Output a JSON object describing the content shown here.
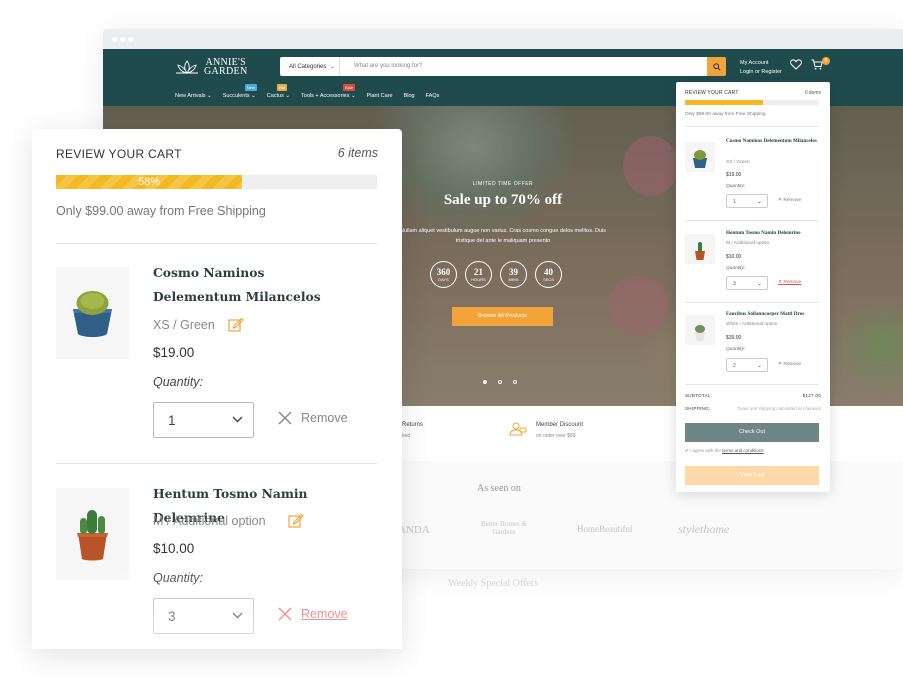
{
  "site": {
    "logo_line1": "ANNIE'S",
    "logo_line2": "GARDEN",
    "category_label": "All Categories",
    "search_placeholder": "What are you looking for?",
    "account_line1": "My Account",
    "account_line2": "Login or Register",
    "cart_count": "6",
    "nav": [
      {
        "label": "New Arrivals",
        "tag": ""
      },
      {
        "label": "Succulents",
        "tag": "New"
      },
      {
        "label": "Cactus",
        "tag": "Hot"
      },
      {
        "label": "Tools + Accessories",
        "tag": "Sale"
      },
      {
        "label": "Plant Care",
        "tag": ""
      },
      {
        "label": "Blog",
        "tag": ""
      },
      {
        "label": "FAQs",
        "tag": ""
      }
    ],
    "colors": {
      "header": "#1f4b4c",
      "accent": "#f2a33a",
      "progress": "#f4b823",
      "tag_new": "#4aa7e0",
      "tag_hot": "#e2b04a",
      "tag_sale": "#d94c3d"
    }
  },
  "hero": {
    "offer": "LIMITED TIME OFFER",
    "headline": "Sale up to 70% off",
    "body": "Nullam aliquet vestibulum augue non varius. Cras cosmo congue delos melitos. Duis tristique del ante le maliquam presento",
    "countdown": [
      {
        "value": "360",
        "unit": "DAYS"
      },
      {
        "value": "21",
        "unit": "HOURS"
      },
      {
        "value": "39",
        "unit": "MINS"
      },
      {
        "value": "40",
        "unit": "SECS"
      }
    ],
    "cta": "Browse All Products"
  },
  "features": [
    {
      "title": "Returns",
      "sub": "ked"
    },
    {
      "title": "Member Discount",
      "sub": "on order over $89"
    }
  ],
  "as_seen_on": {
    "title": "As seen on",
    "brands": [
      "ANDA",
      "Better Homes & Gardens",
      "HomeBeautiful",
      "stylethome"
    ]
  },
  "weekly": "Weekly Special Offers",
  "mini_cart": {
    "title": "REVIEW YOUR CART",
    "count": "6 items",
    "progress": 0.58,
    "free_shipping": "Only $99.00 away from Free Shipping",
    "items": [
      {
        "name": "Cosmo Naminos Delementum Milancelos",
        "variant": "XS / Green",
        "price": "$19.00",
        "qty": "1",
        "remove": "Remove"
      },
      {
        "name": "Hentum Tosmo Namin Delemrine",
        "variant": "M / Additional option",
        "price": "$10.00",
        "qty": "3",
        "remove": "Remove"
      },
      {
        "name": "Faucibus Sollanncorper Mattl Dros",
        "variant": "White / Additional option",
        "price": "$39.00",
        "qty": "2",
        "remove": "Remove"
      }
    ],
    "quantity_label": "Quantity:",
    "subtotal_label": "SUBTOTAL:",
    "subtotal": "$127.00",
    "shipping_label": "SHIPPING:",
    "shipping_note": "Taxes and shipping calculated at checkout",
    "checkout": "Check Out",
    "agree_prefix": "I agree with the",
    "agree_link": "terms and conditions",
    "view_cart": "View Cart"
  },
  "cart": {
    "title": "REVIEW YOUR CART",
    "count": "6 items",
    "progress_text": "58%",
    "progress": 0.58,
    "free_shipping": "Only $99.00 away from Free Shipping",
    "quantity_label": "Quantity:",
    "items": [
      {
        "name": "Cosmo Naminos Delementum Milancelos",
        "variant": "XS / Green",
        "price": "$19.00",
        "qty": "1",
        "remove": "Remove"
      },
      {
        "name": "Hentum Tosmo Namin Delemrine",
        "variant": "M / Additional option",
        "price": "$10.00",
        "qty": "3",
        "remove": "Remove"
      }
    ]
  }
}
